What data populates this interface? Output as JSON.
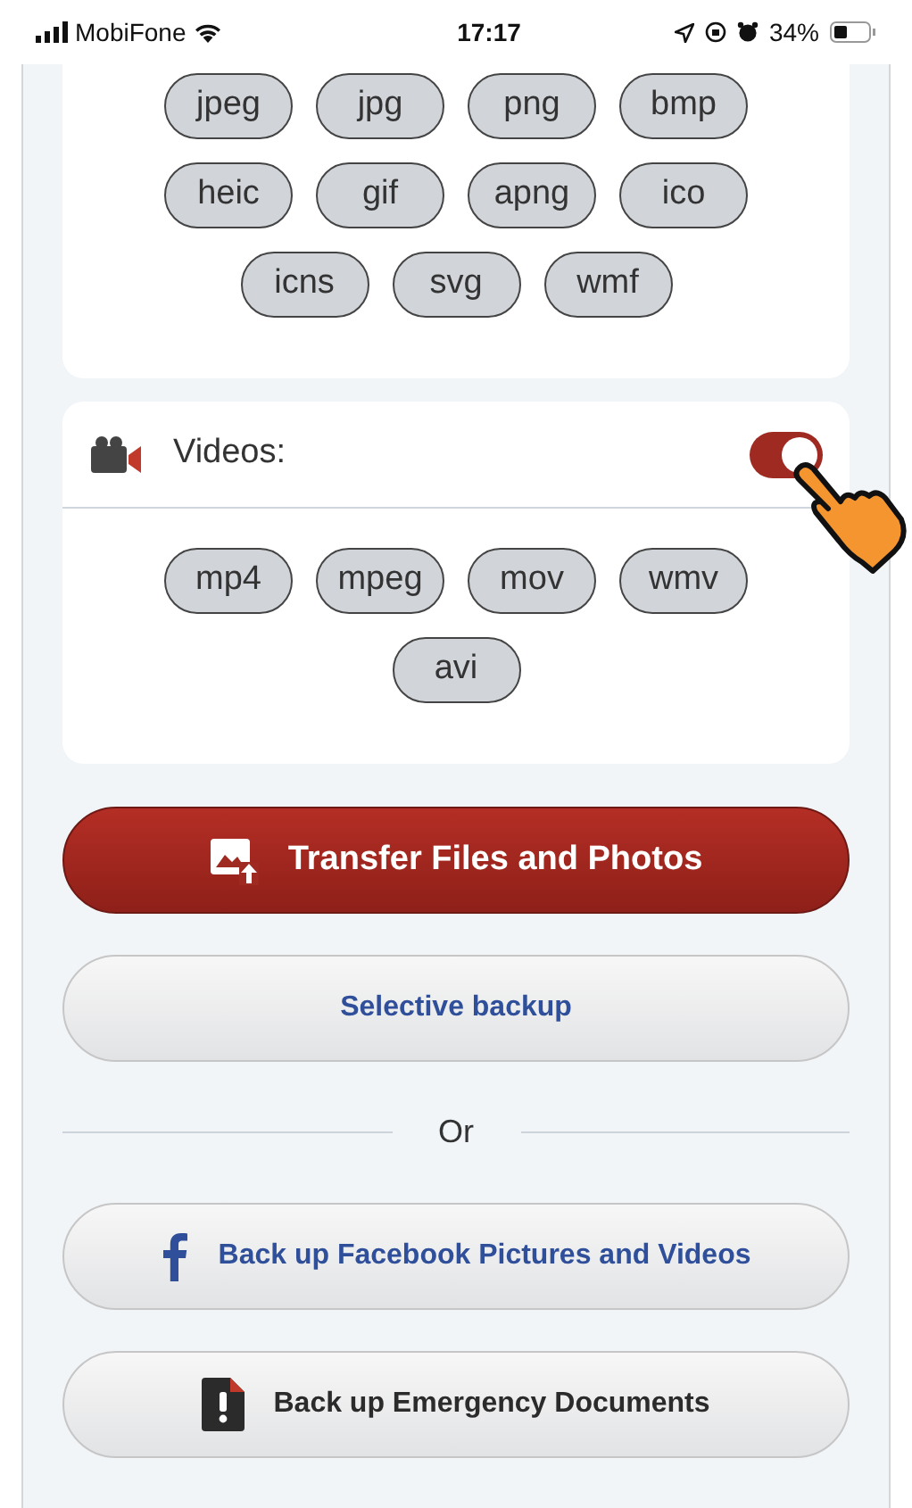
{
  "status_bar": {
    "carrier": "MobiFone",
    "time": "17:17",
    "battery": "34%"
  },
  "images_section": {
    "formats": [
      "jpeg",
      "jpg",
      "png",
      "bmp",
      "heic",
      "gif",
      "apng",
      "ico",
      "icns",
      "svg",
      "wmf"
    ]
  },
  "videos_section": {
    "label": "Videos:",
    "on": true,
    "formats": [
      "mp4",
      "mpeg",
      "mov",
      "wmv",
      "avi"
    ]
  },
  "buttons": [
    {
      "kind": "primary",
      "label": "Transfer Files and Photos"
    },
    {
      "kind": "secondary",
      "label": "Selective backup"
    }
  ],
  "divider_text": "Or",
  "more_buttons": [
    {
      "kind": "facebook",
      "label": "Back up Facebook Pictures and Videos"
    },
    {
      "kind": "emergency",
      "label": "Back up Emergency Documents"
    }
  ]
}
